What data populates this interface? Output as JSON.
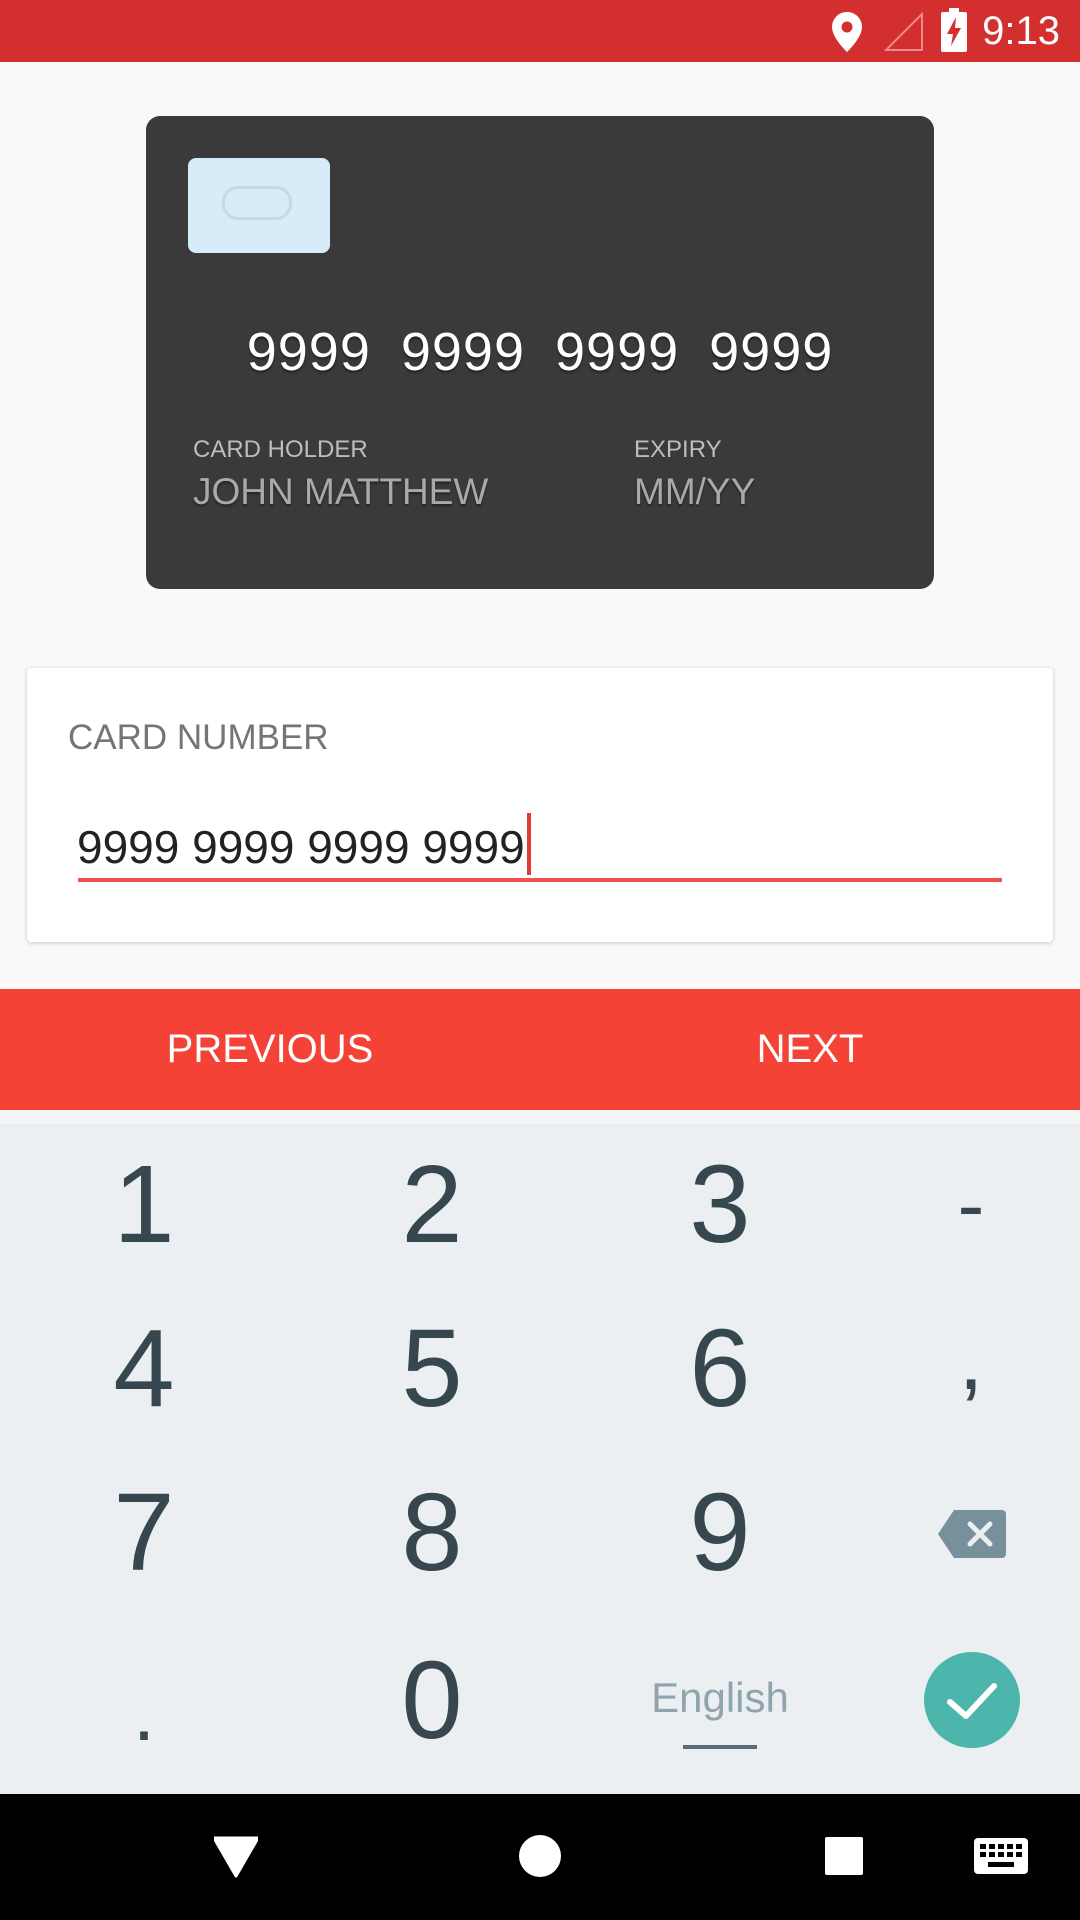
{
  "status_bar": {
    "time": "9:13"
  },
  "card_preview": {
    "number": "9999 9999 9999 9999",
    "holder_label": "CARD HOLDER",
    "holder_value": "JOHN MATTHEW",
    "expiry_label": "EXPIRY",
    "expiry_value": "MM/YY"
  },
  "form": {
    "label": "CARD NUMBER",
    "value": "9999 9999 9999 9999"
  },
  "actions": {
    "previous": "PREVIOUS",
    "next": "NEXT"
  },
  "keyboard": {
    "rows": [
      [
        "1",
        "2",
        "3",
        "-"
      ],
      [
        "4",
        "5",
        "6",
        ","
      ],
      [
        "7",
        "8",
        "9"
      ],
      [
        ".",
        "0"
      ]
    ],
    "language": "English"
  },
  "colors": {
    "status_bar": "#d32f2f",
    "accent": "#f44336",
    "card": "#3b3a3b",
    "done": "#4db6ac"
  }
}
